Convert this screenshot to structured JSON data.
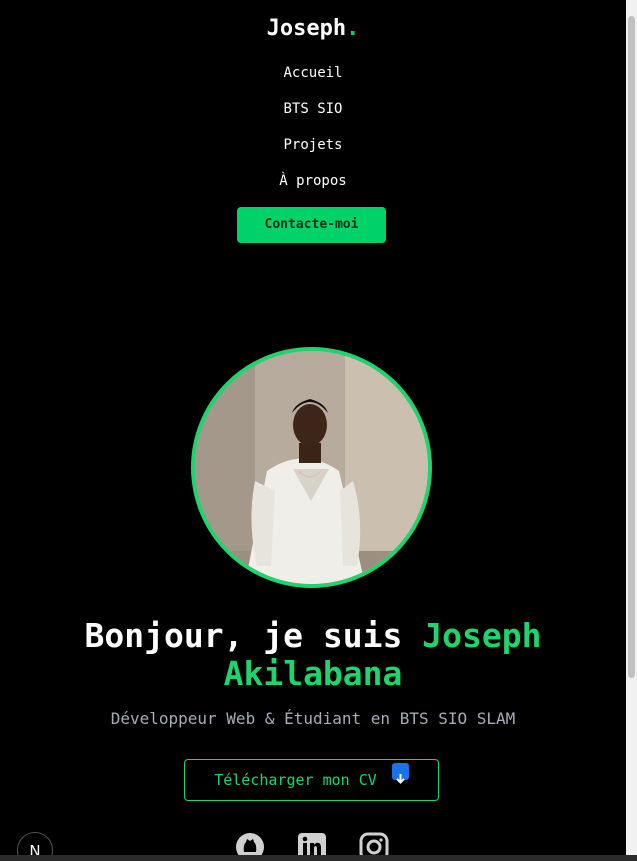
{
  "header": {
    "logo_text": "Joseph",
    "logo_dot": ".",
    "nav": [
      {
        "label": "Accueil"
      },
      {
        "label": "BTS SIO"
      },
      {
        "label": "Projets"
      },
      {
        "label": "À propos"
      }
    ],
    "contact_label": "Contacte-moi"
  },
  "hero": {
    "greeting": "Bonjour, je suis ",
    "first_name": "Joseph",
    "last_name": "Akilabana",
    "subtitle": "Développeur Web & Étudiant en BTS SIO SLAM",
    "cv_label": "Télécharger mon CV",
    "cv_icon": "download-icon"
  },
  "socials": [
    {
      "icon": "github-icon"
    },
    {
      "icon": "linkedin-icon"
    },
    {
      "icon": "instagram-icon"
    }
  ],
  "dev_badge": {
    "label": "N"
  },
  "colors": {
    "accent": "#1fd46c",
    "background": "#000000",
    "subtitle": "#a5adba"
  }
}
